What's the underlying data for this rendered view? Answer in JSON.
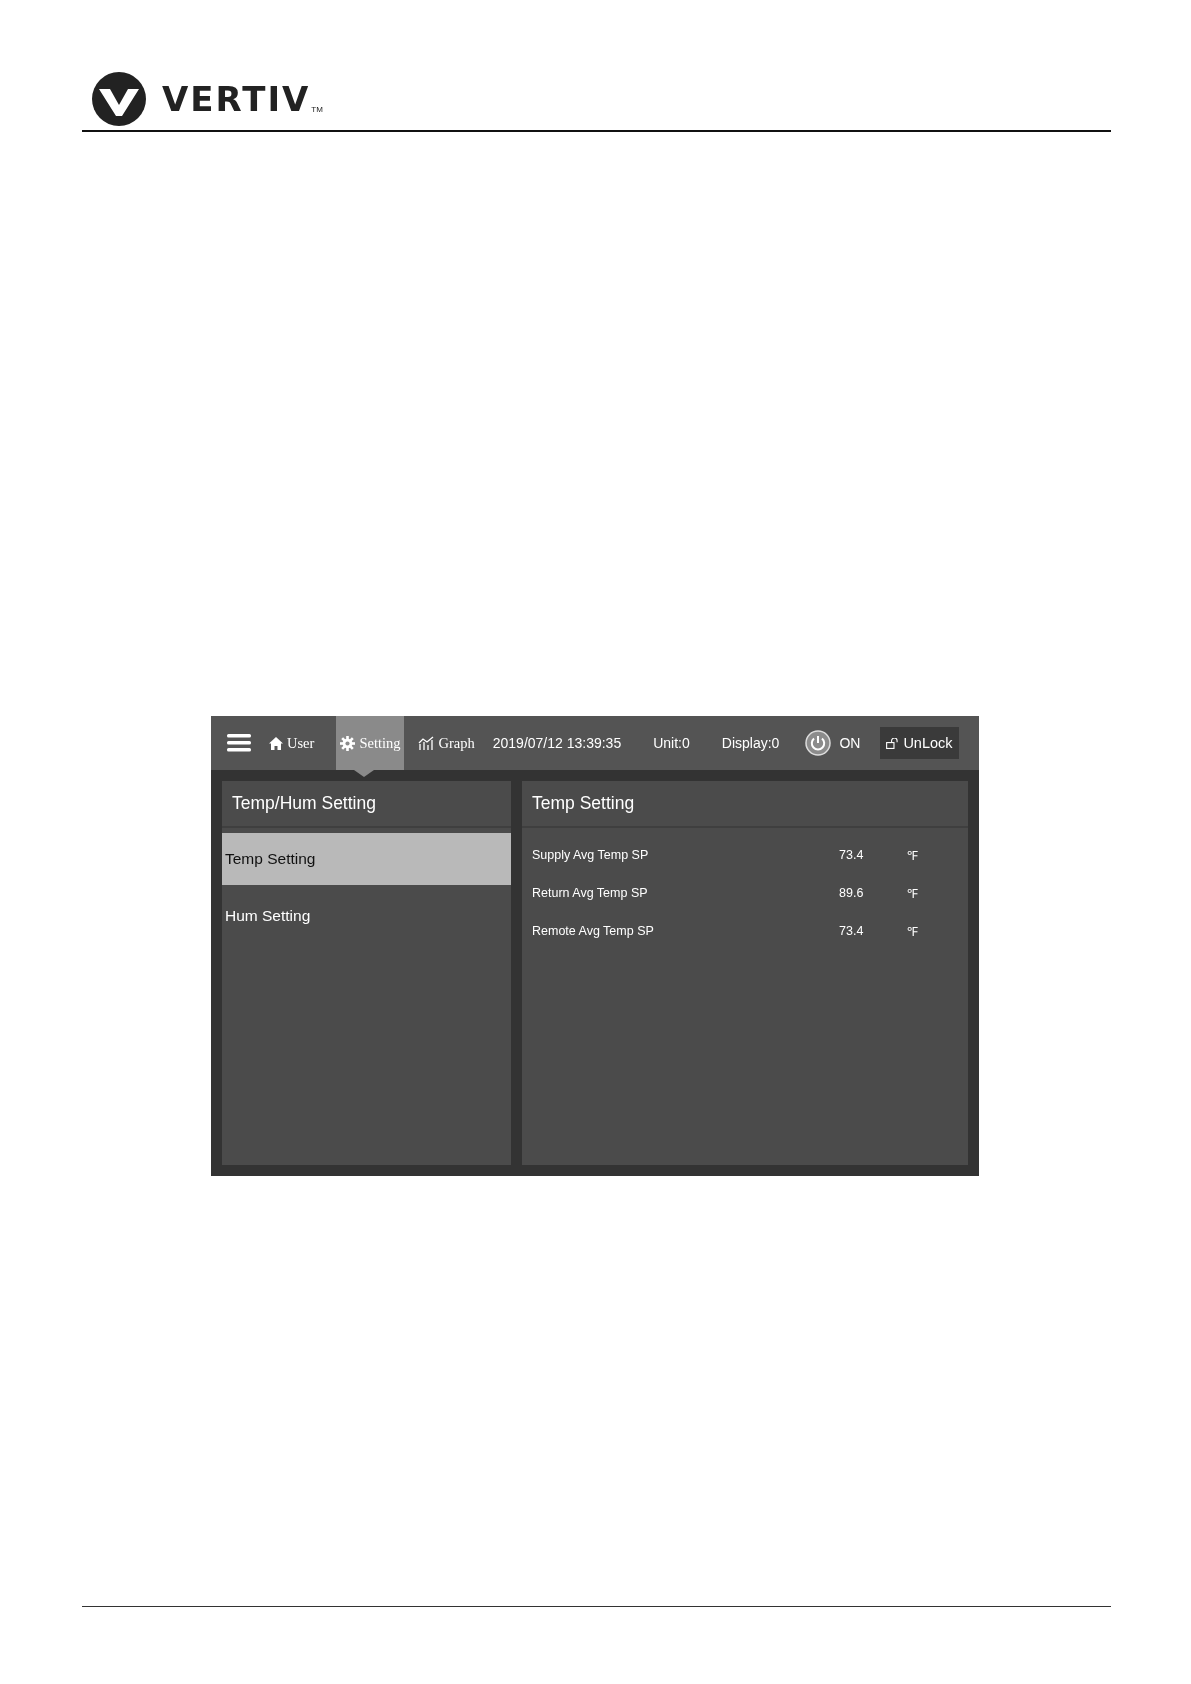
{
  "header": {
    "logo_text": "VERTIV",
    "trademark": "TM"
  },
  "screen": {
    "nav": [
      {
        "label": "User",
        "kind": "home",
        "selected": false
      },
      {
        "label": "Setting",
        "kind": "gear",
        "selected": true
      },
      {
        "label": "Graph",
        "kind": "chart",
        "selected": false
      }
    ],
    "datetime": "2019/07/12 13:39:35",
    "unit": "Unit:0",
    "display": "Display:0",
    "power_label": "ON",
    "lock_button": "UnLock",
    "left_panel": {
      "title": "Temp/Hum Setting",
      "items": [
        {
          "label": "Temp Setting",
          "selected": true
        },
        {
          "label": "Hum Setting",
          "selected": false
        }
      ]
    },
    "right_panel": {
      "title": "Temp Setting",
      "rows": [
        {
          "name": "Supply Avg Temp SP",
          "value": "73.4",
          "unit": "℉"
        },
        {
          "name": "Return Avg Temp SP",
          "value": "89.6",
          "unit": "℉"
        },
        {
          "name": "Remote Avg Temp SP",
          "value": "73.4",
          "unit": "℉"
        }
      ]
    }
  }
}
